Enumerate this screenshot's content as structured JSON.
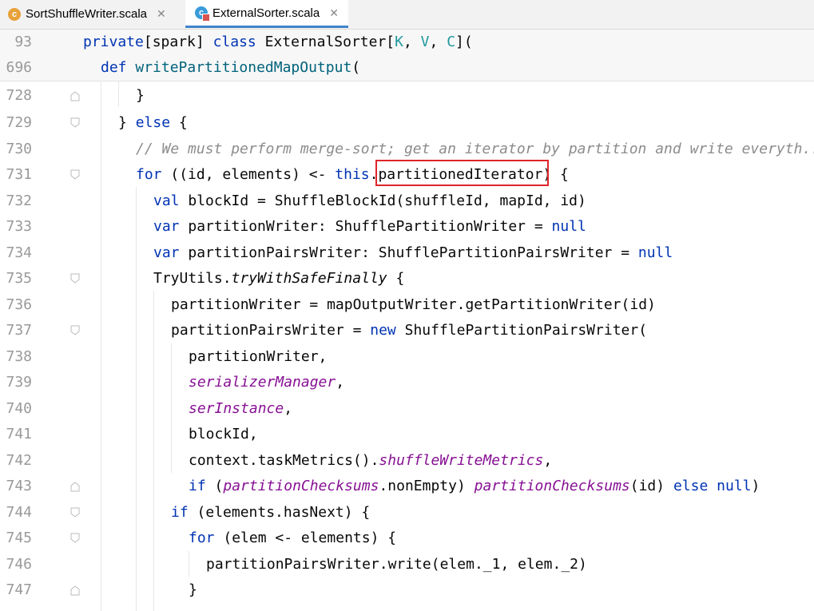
{
  "tabs": [
    {
      "label": "SortShuffleWriter.scala",
      "icon": "scala-class-icon",
      "active": false
    },
    {
      "label": "ExternalSorter.scala",
      "icon": "scala-class-icon",
      "active": true
    }
  ],
  "sticky_lines": [
    {
      "num": "93",
      "text": "private[spark] class ExternalSorter[K, V, C]("
    },
    {
      "num": "696",
      "text": "def writePartitionedMapOutput("
    }
  ],
  "code_lines": [
    {
      "num": "728",
      "text": "}"
    },
    {
      "num": "729",
      "text": "} else {"
    },
    {
      "num": "730",
      "text": "// We must perform merge-sort; get an iterator by partition and write everyth..."
    },
    {
      "num": "731",
      "text": "for ((id, elements) <- this.partitionedIterator) {"
    },
    {
      "num": "732",
      "text": "val blockId = ShuffleBlockId(shuffleId, mapId, id)"
    },
    {
      "num": "733",
      "text": "var partitionWriter: ShufflePartitionWriter = null"
    },
    {
      "num": "734",
      "text": "var partitionPairsWriter: ShufflePartitionPairsWriter = null"
    },
    {
      "num": "735",
      "text": "TryUtils.tryWithSafeFinally {"
    },
    {
      "num": "736",
      "text": "partitionWriter = mapOutputWriter.getPartitionWriter(id)"
    },
    {
      "num": "737",
      "text": "partitionPairsWriter = new ShufflePartitionPairsWriter("
    },
    {
      "num": "738",
      "text": "partitionWriter,"
    },
    {
      "num": "739",
      "text": "serializerManager,"
    },
    {
      "num": "740",
      "text": "serInstance,"
    },
    {
      "num": "741",
      "text": "blockId,"
    },
    {
      "num": "742",
      "text": "context.taskMetrics().shuffleWriteMetrics,"
    },
    {
      "num": "743",
      "text": "if (partitionChecksums.nonEmpty) partitionChecksums(id) else null)"
    },
    {
      "num": "744",
      "text": "if (elements.hasNext) {"
    },
    {
      "num": "745",
      "text": "for (elem <- elements) {"
    },
    {
      "num": "746",
      "text": "partitionPairsWriter.write(elem._1, elem._2)"
    },
    {
      "num": "747",
      "text": "}"
    }
  ],
  "highlight": {
    "text": "partitionedIterator",
    "color": "#e0232a"
  },
  "colors": {
    "keyword": "#0033b3",
    "comment": "#8c8c8c",
    "field": "#871094",
    "function": "#00627a",
    "generic": "#20999d"
  }
}
